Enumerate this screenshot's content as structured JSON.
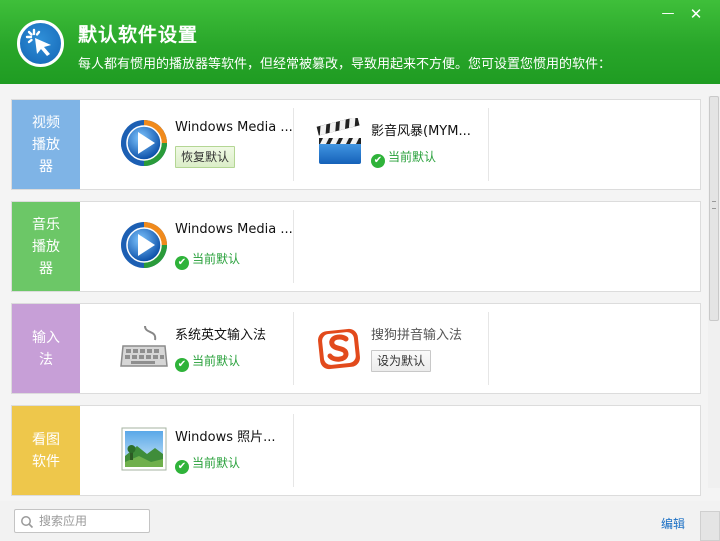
{
  "header": {
    "title": "默认软件设置",
    "subtitle": "每人都有惯用的播放器等软件，但经常被篡改，导致用起来不方便。您可设置您惯用的软件：",
    "minimize_label": "—",
    "close_label": "✕"
  },
  "categories": [
    {
      "tab_lines": [
        "视频",
        "播放器"
      ],
      "apps": [
        {
          "name": "Windows Media ...",
          "icon": "windows-media-player-icon",
          "action": "恢复默认"
        },
        {
          "name": "影音风暴(MYM...",
          "icon": "clapperboard-icon",
          "status": "当前默认"
        }
      ]
    },
    {
      "tab_lines": [
        "音乐",
        "播放器"
      ],
      "apps": [
        {
          "name": "Windows Media ...",
          "icon": "windows-media-player-icon",
          "status": "当前默认"
        }
      ]
    },
    {
      "tab_lines": [
        "输入法"
      ],
      "apps": [
        {
          "name": "系统英文输入法",
          "icon": "keyboard-icon",
          "status": "当前默认"
        },
        {
          "name": "搜狗拼音输入法",
          "icon": "sogou-icon",
          "action": "设为默认"
        }
      ]
    },
    {
      "tab_lines": [
        "看图",
        "软件"
      ],
      "apps": [
        {
          "name": "Windows 照片...",
          "icon": "photo-landscape-icon",
          "status": "当前默认"
        }
      ]
    }
  ],
  "footer": {
    "search_placeholder": "搜索应用",
    "edit_label": "编辑"
  },
  "colors": {
    "header_green": "#29a62a",
    "tab_video": "#7fb4e6",
    "tab_music": "#6cc767",
    "tab_ime": "#c79fd7",
    "tab_image": "#eec74b",
    "status_green": "#27a03a",
    "link_blue": "#1a6fc4"
  }
}
